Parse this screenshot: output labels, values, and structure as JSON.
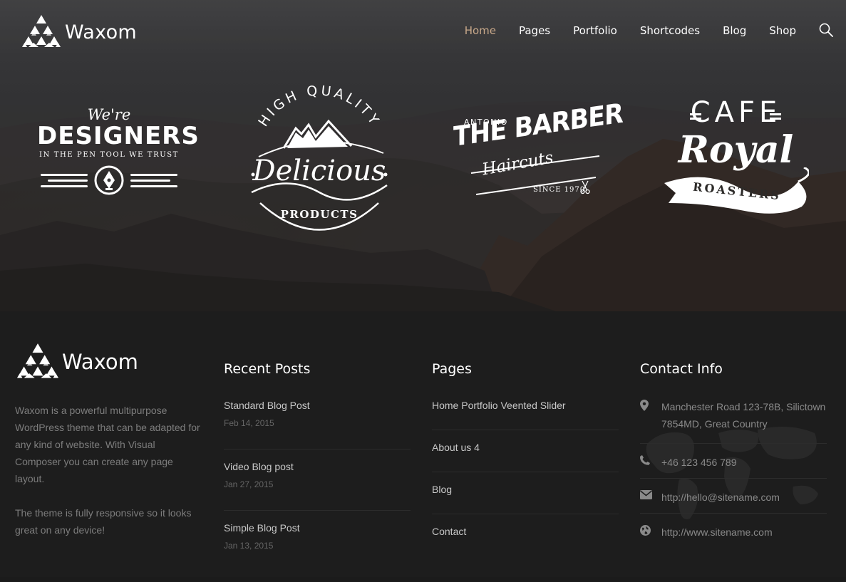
{
  "header": {
    "brand": "Waxom",
    "nav": [
      {
        "label": "Home",
        "active": true
      },
      {
        "label": "Pages",
        "active": false
      },
      {
        "label": "Portfolio",
        "active": false
      },
      {
        "label": "Shortcodes",
        "active": false
      },
      {
        "label": "Blog",
        "active": false
      },
      {
        "label": "Shop",
        "active": false
      }
    ],
    "search_icon": "search-icon"
  },
  "badges": {
    "designers": {
      "top": "We're",
      "main": "DESIGNERS",
      "sub": "IN THE PEN TOOL WE TRUST"
    },
    "delicious": {
      "arc": "HIGH QUALITY",
      "main": "Delicious",
      "sub": "PRODUCTS"
    },
    "barber": {
      "top": "ANTONIO",
      "main": "THE BARBER",
      "script": "Haircuts",
      "since": "SINCE 1970"
    },
    "cafe": {
      "top": "CAFE",
      "main": "Royal",
      "ribbon": "ROASTERS"
    }
  },
  "footer": {
    "brand": "Waxom",
    "about": [
      "Waxom is a powerful multipurpose WordPress theme that can be adapted for any kind of website. With Visual Composer you can create any page layout.",
      "The theme is fully responsive so it looks great on any device!"
    ],
    "recent_posts": {
      "title": "Recent Posts",
      "items": [
        {
          "title": "Standard Blog Post",
          "date": "Feb 14, 2015"
        },
        {
          "title": "Video Blog post",
          "date": "Jan 27, 2015"
        },
        {
          "title": "Simple Blog Post",
          "date": "Jan 13, 2015"
        }
      ]
    },
    "pages": {
      "title": "Pages",
      "items": [
        "Home Portfolio Veented Slider",
        "About us 4",
        "Blog",
        "Contact"
      ]
    },
    "contact": {
      "title": "Contact Info",
      "address": "Manchester Road 123-78B, Silictown 7854MD, Great Country",
      "phone": "+46 123 456 789",
      "email": "http://hello@sitename.com",
      "web": "http://www.sitename.com"
    }
  },
  "colors": {
    "accent": "#c9a98a",
    "footer_bg": "#1d1d1d"
  }
}
